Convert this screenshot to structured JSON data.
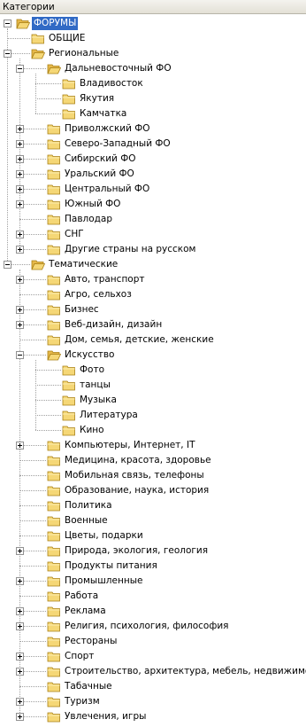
{
  "panel": {
    "title": "Категории"
  },
  "colors": {
    "selection": "#316ac5",
    "folder": "#f5d776"
  },
  "icons": {
    "collapsed": "plus-box",
    "expanded": "minus-box",
    "node": "folder-icon"
  },
  "tree": [
    {
      "label": "ФОРУМЫ",
      "level": 0,
      "expander": "minus",
      "selected": true
    },
    {
      "label": "ОБЩИЕ",
      "level": 1,
      "expander": null
    },
    {
      "label": "Региональные",
      "level": 1,
      "expander": "minus"
    },
    {
      "label": "Дальневосточный ФО",
      "level": 2,
      "expander": "minus"
    },
    {
      "label": "Владивосток",
      "level": 3,
      "expander": null
    },
    {
      "label": "Якутия",
      "level": 3,
      "expander": null
    },
    {
      "label": "Камчатка",
      "level": 3,
      "expander": null
    },
    {
      "label": "Приволжский ФО",
      "level": 2,
      "expander": "plus"
    },
    {
      "label": "Северо-Западный ФО",
      "level": 2,
      "expander": "plus"
    },
    {
      "label": "Сибирский ФО",
      "level": 2,
      "expander": "plus"
    },
    {
      "label": "Уральский ФО",
      "level": 2,
      "expander": "plus"
    },
    {
      "label": "Центральный ФО",
      "level": 2,
      "expander": "plus"
    },
    {
      "label": "Южный ФО",
      "level": 2,
      "expander": "plus"
    },
    {
      "label": "Павлодар",
      "level": 2,
      "expander": null
    },
    {
      "label": "СНГ",
      "level": 2,
      "expander": "plus"
    },
    {
      "label": "Другие страны на русском",
      "level": 2,
      "expander": "plus"
    },
    {
      "label": "Тематические",
      "level": 1,
      "expander": "minus"
    },
    {
      "label": "Авто, транспорт",
      "level": 2,
      "expander": "plus"
    },
    {
      "label": "Агро, сельхоз",
      "level": 2,
      "expander": null
    },
    {
      "label": "Бизнес",
      "level": 2,
      "expander": "plus"
    },
    {
      "label": "Веб-дизайн, дизайн",
      "level": 2,
      "expander": "plus"
    },
    {
      "label": "Дом, семья, детские, женские",
      "level": 2,
      "expander": null
    },
    {
      "label": "Искусство",
      "level": 2,
      "expander": "minus"
    },
    {
      "label": "Фото",
      "level": 3,
      "expander": null
    },
    {
      "label": "танцы",
      "level": 3,
      "expander": null
    },
    {
      "label": "Музыка",
      "level": 3,
      "expander": null
    },
    {
      "label": "Литература",
      "level": 3,
      "expander": null
    },
    {
      "label": "Кино",
      "level": 3,
      "expander": null
    },
    {
      "label": "Компьютеры, Интернет, IT",
      "level": 2,
      "expander": "plus"
    },
    {
      "label": "Медицина, красота, здоровье",
      "level": 2,
      "expander": null
    },
    {
      "label": "Мобильная связь, телефоны",
      "level": 2,
      "expander": null
    },
    {
      "label": "Образование, наука, история",
      "level": 2,
      "expander": null
    },
    {
      "label": "Политика",
      "level": 2,
      "expander": null
    },
    {
      "label": "Военные",
      "level": 2,
      "expander": null
    },
    {
      "label": "Цветы, подарки",
      "level": 2,
      "expander": null
    },
    {
      "label": "Природа, экология, геология",
      "level": 2,
      "expander": "plus"
    },
    {
      "label": "Продукты питания",
      "level": 2,
      "expander": null
    },
    {
      "label": "Промышленные",
      "level": 2,
      "expander": "plus"
    },
    {
      "label": "Работа",
      "level": 2,
      "expander": null
    },
    {
      "label": "Реклама",
      "level": 2,
      "expander": "plus"
    },
    {
      "label": "Религия, психология, философия",
      "level": 2,
      "expander": "plus"
    },
    {
      "label": "Рестораны",
      "level": 2,
      "expander": null
    },
    {
      "label": "Спорт",
      "level": 2,
      "expander": "plus"
    },
    {
      "label": "Строительство, архитектура, мебель, недвижимость",
      "level": 2,
      "expander": "plus"
    },
    {
      "label": "Табачные",
      "level": 2,
      "expander": null
    },
    {
      "label": "Туризм",
      "level": 2,
      "expander": "plus"
    },
    {
      "label": "Увлечения, игры",
      "level": 2,
      "expander": "plus"
    }
  ]
}
